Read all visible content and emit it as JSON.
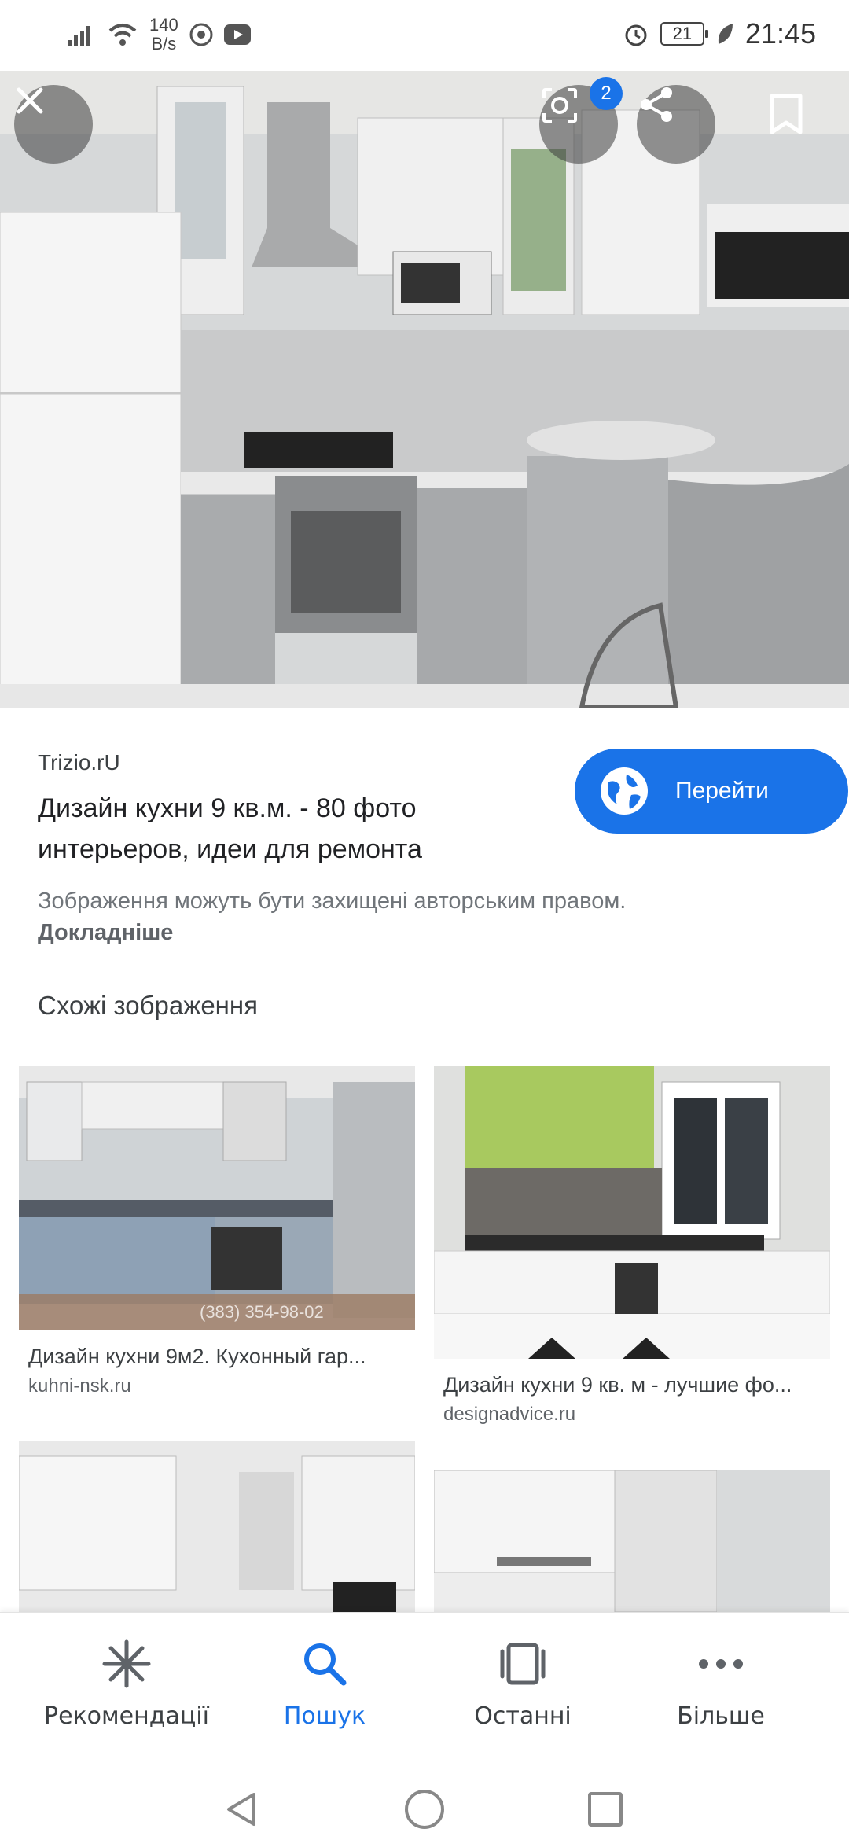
{
  "status_bar": {
    "net_speed_value": "140",
    "net_speed_unit": "B/s",
    "battery": "21",
    "time": "21:45"
  },
  "viewer": {
    "lens_badge": "2",
    "icons": [
      "close-icon",
      "lens-icon",
      "share-icon",
      "bookmark-icon"
    ]
  },
  "result": {
    "source": "Trizio.rU",
    "title": "Дизайн кухни 9 кв.м. - 80 фото интерьеров, идеи для ремонта",
    "goto_label": "Перейти",
    "copyright": "Зображення можуть бути захищені авторським правом.",
    "more_link": "Докладніше"
  },
  "similar": {
    "heading": "Схожі зображення",
    "items": [
      {
        "caption": "Дизайн кухни 9м2. Кухонный гар...",
        "domain": "kuhni-nsk.ru",
        "watermark": "(383) 354-98-02"
      },
      {
        "caption": "Дизайн кухни 9 кв. м - лучшие фо...",
        "domain": "designadvice.ru"
      },
      {
        "caption": "",
        "domain": ""
      },
      {
        "caption": "",
        "domain": ""
      }
    ]
  },
  "bottom_nav": {
    "items": [
      {
        "label": "Рекомендації",
        "icon": "asterisk-icon"
      },
      {
        "label": "Пошук",
        "icon": "search-icon",
        "active": true
      },
      {
        "label": "Останні",
        "icon": "recent-icon"
      },
      {
        "label": "Більше",
        "icon": "more-icon"
      }
    ]
  },
  "colors": {
    "accent": "#1a73e8",
    "text": "#202124",
    "muted": "#70757a"
  }
}
